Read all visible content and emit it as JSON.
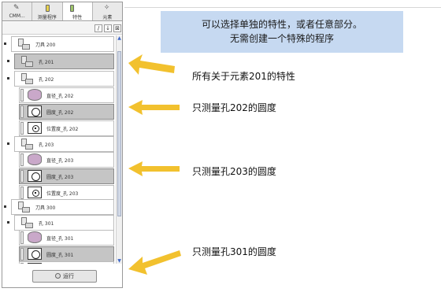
{
  "tabs": [
    {
      "label": "CMM...",
      "icon": "wrench-icon"
    },
    {
      "label": "测量程序",
      "icon": "program-icon"
    },
    {
      "label": "特性",
      "icon": "feature-icon"
    },
    {
      "label": "元素",
      "icon": "element-icon"
    }
  ],
  "toolbar": {
    "edit": "/",
    "down": "↓",
    "delete": "⊠"
  },
  "tree": [
    {
      "label": "刀具 200",
      "icon": "tool"
    },
    {
      "label": "孔 201",
      "icon": "tool"
    },
    {
      "label": "孔 202",
      "icon": "tool"
    },
    {
      "label": "直径_孔 202",
      "icon": "cyl"
    },
    {
      "label": "圆度_孔 202",
      "icon": "circ"
    },
    {
      "label": "位置度_孔 202",
      "icon": "pos"
    },
    {
      "label": "孔 203",
      "icon": "tool"
    },
    {
      "label": "直径_孔 203",
      "icon": "cyl"
    },
    {
      "label": "圆度_孔 203",
      "icon": "circ"
    },
    {
      "label": "位置度_孔 203",
      "icon": "pos"
    },
    {
      "label": "刀具 300",
      "icon": "tool"
    },
    {
      "label": "孔 301",
      "icon": "tool"
    },
    {
      "label": "直径_孔 301",
      "icon": "cyl"
    },
    {
      "label": "圆度_孔 301",
      "icon": "circ"
    },
    {
      "label": "",
      "icon": "circ"
    }
  ],
  "run_button": "运行",
  "caption": {
    "line1": "可以选择单独的特性，或者任意部分。",
    "line2": "无需创建一个特殊的程序"
  },
  "notes": {
    "n1": "所有关于元素201的特性",
    "n2": "只测量孔202的圆度",
    "n3": "只测量孔203的圆度",
    "n4": "只测量孔301的圆度"
  },
  "colors": {
    "arrow": "#f2c12e",
    "caption_bg": "#c6d9f1",
    "selected_row": "#c5c5c5"
  }
}
